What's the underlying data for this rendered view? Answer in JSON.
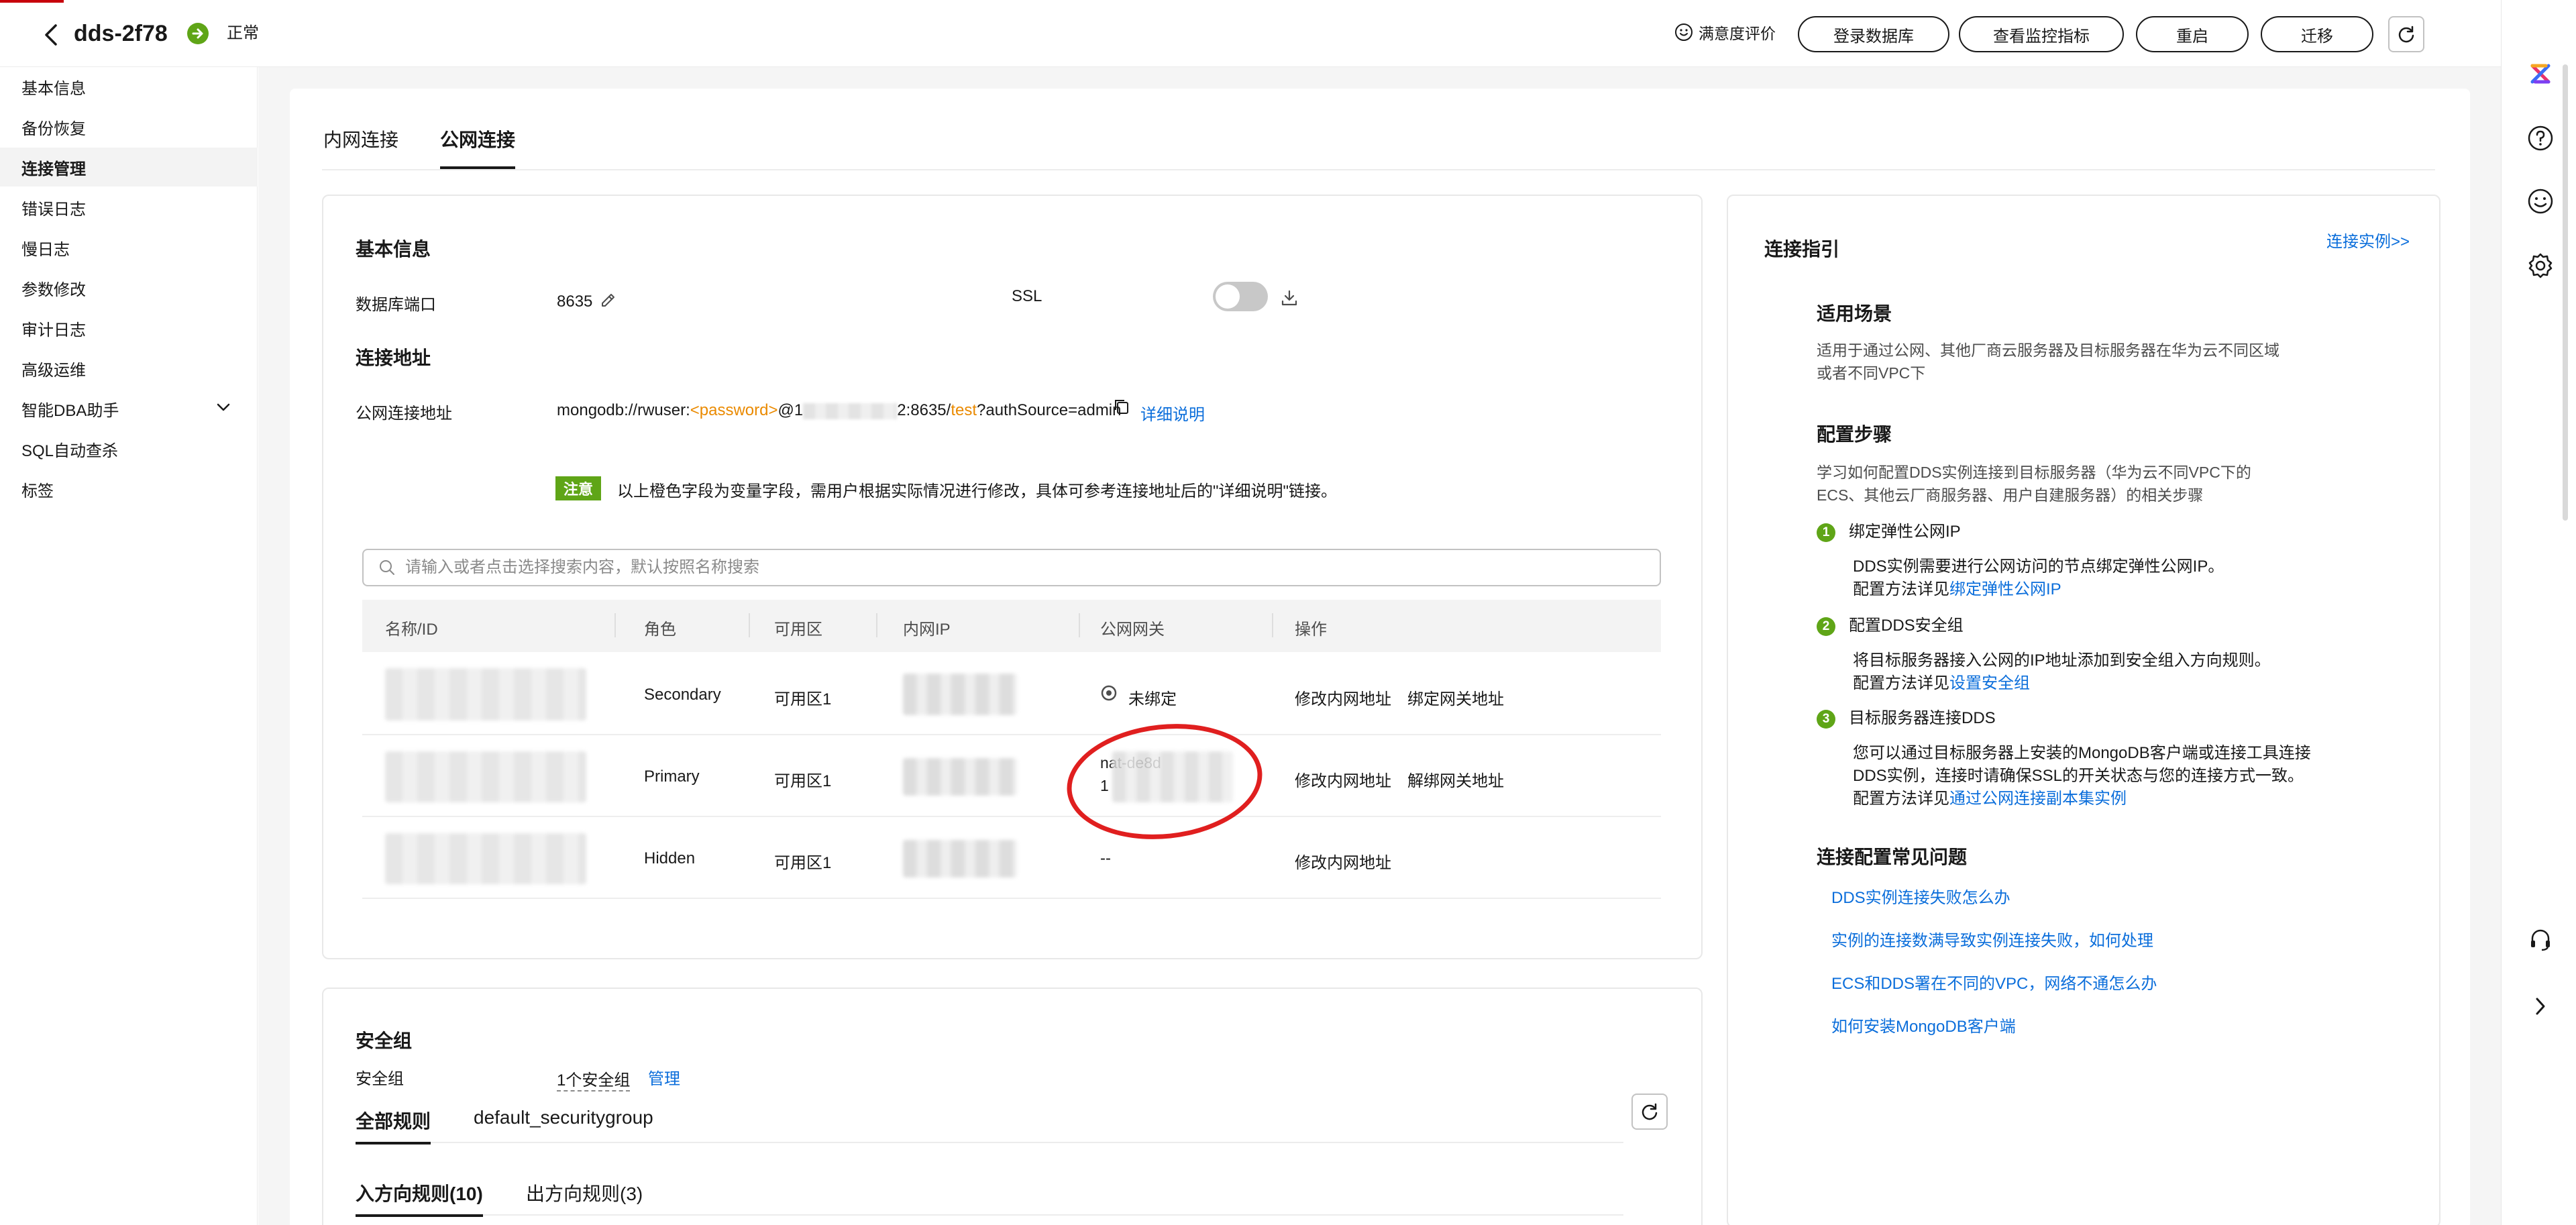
{
  "header": {
    "instance_name": "dds-2f78",
    "status": "正常",
    "satisfaction": "满意度评价",
    "buttons": [
      "登录数据库",
      "查看监控指标",
      "重启",
      "迁移"
    ]
  },
  "sidebar": {
    "items": [
      {
        "label": "基本信息"
      },
      {
        "label": "备份恢复"
      },
      {
        "label": "连接管理"
      },
      {
        "label": "错误日志"
      },
      {
        "label": "慢日志"
      },
      {
        "label": "参数修改"
      },
      {
        "label": "审计日志"
      },
      {
        "label": "高级运维"
      },
      {
        "label": "智能DBA助手"
      },
      {
        "label": "SQL自动查杀"
      },
      {
        "label": "标签"
      }
    ]
  },
  "tabs": [
    "内网连接",
    "公网连接"
  ],
  "basic_info": {
    "title": "基本信息",
    "port_label": "数据库端口",
    "port_value": "8635",
    "ssl_label": "SSL"
  },
  "conn_addr": {
    "title": "连接地址",
    "label": "公网连接地址",
    "prefix": "mongodb://rwuser:",
    "password_var": "<password>",
    "at": "@1",
    "mid": "2:8635/",
    "db_var": "test",
    "suffix": "?authSource=admin",
    "detail_link": "详细说明"
  },
  "notice": {
    "badge": "注意",
    "text": "以上橙色字段为变量字段，需用户根据实际情况进行修改，具体可参考连接地址后的\"详细说明\"链接。"
  },
  "search": {
    "placeholder": "请输入或者点击选择搜索内容，默认按照名称搜索"
  },
  "table": {
    "columns": [
      "名称/ID",
      "角色",
      "可用区",
      "内网IP",
      "公网网关",
      "操作"
    ],
    "rows": [
      {
        "role": "Secondary",
        "az": "可用区1",
        "gateway": "未绑定",
        "actions": [
          "修改内网地址",
          "绑定网关地址"
        ]
      },
      {
        "role": "Primary",
        "az": "可用区1",
        "gateway_line1": "nat-de8d",
        "gateway_line2": "1",
        "actions": [
          "修改内网地址",
          "解绑网关地址"
        ]
      },
      {
        "role": "Hidden",
        "az": "可用区1",
        "gateway": "--",
        "actions": [
          "修改内网地址"
        ]
      }
    ]
  },
  "security": {
    "title": "安全组",
    "label": "安全组",
    "count": "1个安全组",
    "manage": "管理",
    "tabs": [
      "全部规则",
      "default_securitygroup"
    ],
    "rule_tabs": [
      "入方向规则(10)",
      "出方向规则(3)"
    ]
  },
  "guide": {
    "title": "连接指引",
    "instance_link": "连接实例>>",
    "scene_title": "适用场景",
    "scene_text_1": "适用于通过公网、其他厂商云服务器及目标服务器在华为云不同区域",
    "scene_text_2": "或者不同VPC下",
    "steps_title": "配置步骤",
    "steps_text_1": "学习如何配置DDS实例连接到目标服务器（华为云不同VPC下的",
    "steps_text_2": "ECS、其他云厂商服务器、用户自建服务器）的相关步骤",
    "steps": [
      {
        "num": "1",
        "title": "绑定弹性公网IP",
        "desc_1": "DDS实例需要进行公网访问的节点绑定弹性公网IP。",
        "method": "配置方法详见",
        "link": "绑定弹性公网IP"
      },
      {
        "num": "2",
        "title": "配置DDS安全组",
        "desc_1": "将目标服务器接入公网的IP地址添加到安全组入方向规则。",
        "method": "配置方法详见",
        "link": "设置安全组"
      },
      {
        "num": "3",
        "title": "目标服务器连接DDS",
        "desc_1": "您可以通过目标服务器上安装的MongoDB客户端或连接工具连接",
        "desc_2": "DDS实例，连接时请确保SSL的开关状态与您的连接方式一致。",
        "method": "配置方法详见",
        "link": "通过公网连接副本集实例"
      }
    ],
    "faq_title": "连接配置常见问题",
    "faq": [
      "DDS实例连接失败怎么办",
      "实例的连接数满导致实例连接失败，如何处理",
      "ECS和DDS署在不同的VPC，网络不通怎么办",
      "如何安装MongoDB客户端"
    ]
  },
  "colors": {
    "accent": "#0b6edb",
    "ok": "#5fa517",
    "variable": "#ea8a00",
    "annotation": "#e01f1f"
  }
}
